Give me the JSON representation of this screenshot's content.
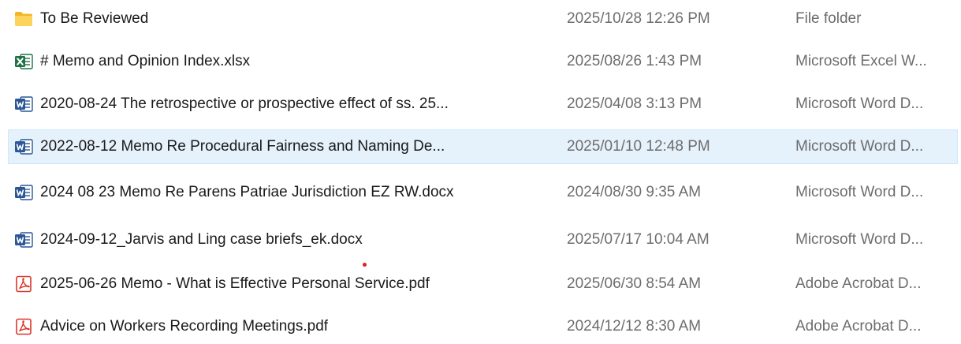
{
  "files": [
    {
      "name": "To Be Reviewed",
      "date_modified": "2025/10/28 12:26 PM",
      "type": "File folder",
      "icon": "folder-icon",
      "selected": false
    },
    {
      "name": "# Memo and Opinion Index.xlsx",
      "date_modified": "2025/08/26 1:43 PM",
      "type": "Microsoft Excel W...",
      "icon": "excel-file-icon",
      "selected": false
    },
    {
      "name": "2020-08-24 The retrospective or prospective effect of ss. 25...",
      "date_modified": "2025/04/08 3:13 PM",
      "type": "Microsoft Word D...",
      "icon": "word-file-icon",
      "selected": false
    },
    {
      "name": "2022-08-12 Memo Re Procedural Fairness and Naming De...",
      "date_modified": "2025/01/10 12:48 PM",
      "type": "Microsoft Word D...",
      "icon": "word-file-icon",
      "selected": true
    },
    {
      "name": "2024 08 23 Memo Re Parens Patriae Jurisdiction EZ RW.docx",
      "date_modified": "2024/08/30 9:35 AM",
      "type": "Microsoft Word D...",
      "icon": "word-file-icon",
      "selected": false
    },
    {
      "name": "2024-09-12_Jarvis and Ling case briefs_ek.docx",
      "date_modified": "2025/07/17 10:04 AM",
      "type": "Microsoft Word D...",
      "icon": "word-file-icon",
      "selected": false
    },
    {
      "name": "2025-06-26 Memo - What is Effective Personal Service.pdf",
      "date_modified": "2025/06/30 8:54 AM",
      "type": "Adobe Acrobat D...",
      "icon": "pdf-file-icon",
      "selected": false
    },
    {
      "name": "Advice on Workers Recording Meetings.pdf",
      "date_modified": "2024/12/12 8:30 AM",
      "type": "Adobe Acrobat D...",
      "icon": "pdf-file-icon",
      "selected": false
    }
  ],
  "colors": {
    "selection_background": "#e5f1fb",
    "selection_border": "#cce8ff",
    "folder": "#f8c73f",
    "excel": "#1e7145",
    "word": "#2b5797",
    "pdf": "#d9372b",
    "secondary_text": "#6d6d6d"
  }
}
